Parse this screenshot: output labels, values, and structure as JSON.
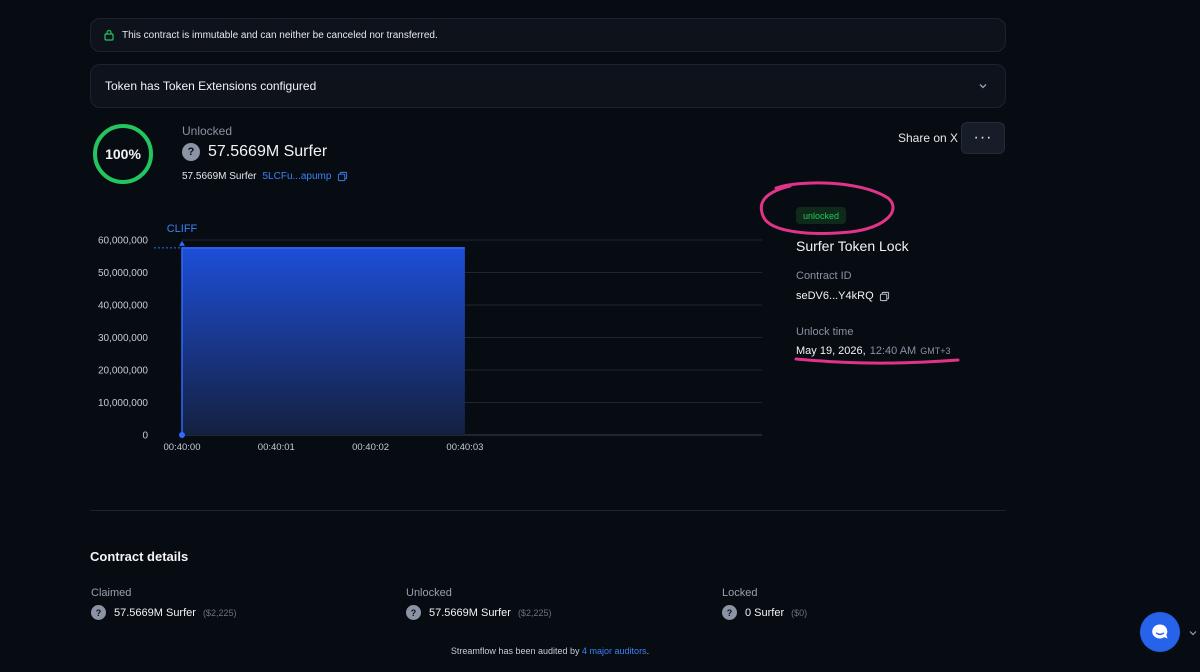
{
  "banner": {
    "text": "This contract is immutable and can neither be canceled nor transferred."
  },
  "extensions": {
    "label": "Token has Token Extensions configured"
  },
  "summary": {
    "percent": "100%",
    "percent_value": 1.0,
    "caption": "Unlocked",
    "amount": "57.5669M Surfer",
    "sub_amount": "57.5669M Surfer",
    "token_address": "5LCFu...apump"
  },
  "actions": {
    "share_label": "Share on X",
    "more_label": "···"
  },
  "chart_data": {
    "type": "area",
    "annotation": "CLIFF",
    "x_ticks": [
      "00:40:00",
      "00:40:01",
      "00:40:02",
      "00:40:03"
    ],
    "y_ticks": [
      "60,000,000",
      "50,000,000",
      "40,000,000",
      "30,000,000",
      "20,000,000",
      "10,000,000",
      "0"
    ],
    "ylim": [
      0,
      60000000
    ],
    "series": [
      {
        "x": [
          0,
          0,
          3
        ],
        "y": [
          0,
          57566900,
          57566900
        ]
      }
    ],
    "grid": true
  },
  "contract": {
    "status": "unlocked",
    "title": "Surfer Token Lock",
    "id_label": "Contract ID",
    "id_value": "seDV6...Y4kRQ",
    "unlock_label": "Unlock time",
    "unlock_date": "May 19, 2026,",
    "unlock_time": "12:40 AM",
    "unlock_tz": "GMT+3"
  },
  "details": {
    "title": "Contract details",
    "items": [
      {
        "label": "Claimed",
        "value": "57.5669M Surfer",
        "usd": "($2,225)"
      },
      {
        "label": "Unlocked",
        "value": "57.5669M Surfer",
        "usd": "($2,225)"
      },
      {
        "label": "Locked",
        "value": "0 Surfer",
        "usd": "($0)"
      }
    ]
  },
  "footer": {
    "prefix": "Streamflow has been audited by",
    "link": "4 major auditors",
    "suffix": "."
  },
  "colors": {
    "accent": "#3b82f6",
    "success": "#22c55e",
    "annotation": "#e2338a",
    "chart_fill": "#1d4ed8"
  }
}
